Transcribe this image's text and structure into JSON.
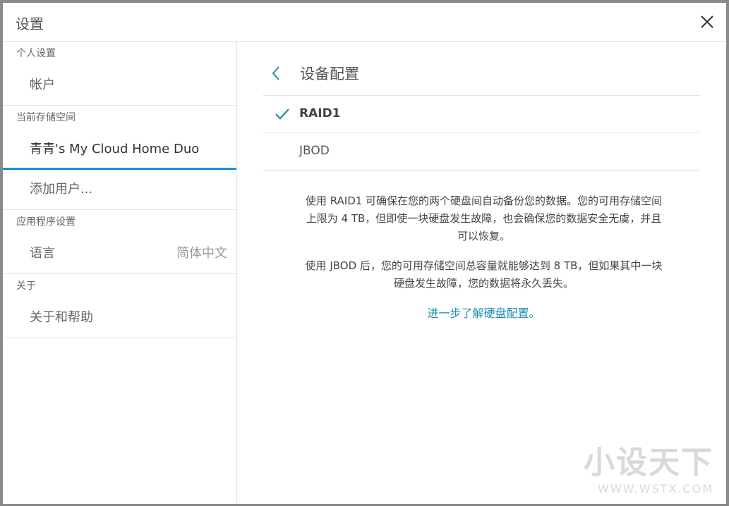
{
  "dialog": {
    "title": "设置",
    "close_icon": "close-icon"
  },
  "sidebar": {
    "sections": [
      {
        "header": "个人设置",
        "items": [
          {
            "label": "帐户"
          }
        ]
      },
      {
        "header": "当前存储空间",
        "items": [
          {
            "label": "青青's My Cloud Home Duo",
            "active": true
          },
          {
            "label": "添加用户..."
          }
        ]
      },
      {
        "header": "应用程序设置",
        "items": [
          {
            "label": "语言",
            "value": "简体中文"
          }
        ]
      },
      {
        "header": "关于",
        "items": [
          {
            "label": "关于和帮助"
          }
        ]
      }
    ]
  },
  "main": {
    "back_icon": "chevron-left-icon",
    "title": "设备配置",
    "options": [
      {
        "label": "RAID1",
        "selected": true
      },
      {
        "label": "JBOD",
        "selected": false
      }
    ],
    "desc_raid1": [
      "使用 RAID1 可确保在您的两个硬盘间自动备份您的数据。您的可用存储空间",
      "上限为 4 TB，但即使一块硬盘发生故障，也会确保您的数据安全无虞，并且",
      "可以恢复。"
    ],
    "desc_jbod": [
      "使用 JBOD 后，您的可用存储空间总容量就能够达到 8 TB，但如果其中一块",
      "硬盘发生故障，您的数据将永久丢失。"
    ],
    "link": "进一步了解硬盘配置。"
  },
  "watermark": {
    "line1": "小设天下",
    "line2": "WWW.WSTX.COM"
  },
  "colors": {
    "accent": "#1a8cd8",
    "link": "#1a8cb0",
    "check": "#1a8cb0"
  }
}
